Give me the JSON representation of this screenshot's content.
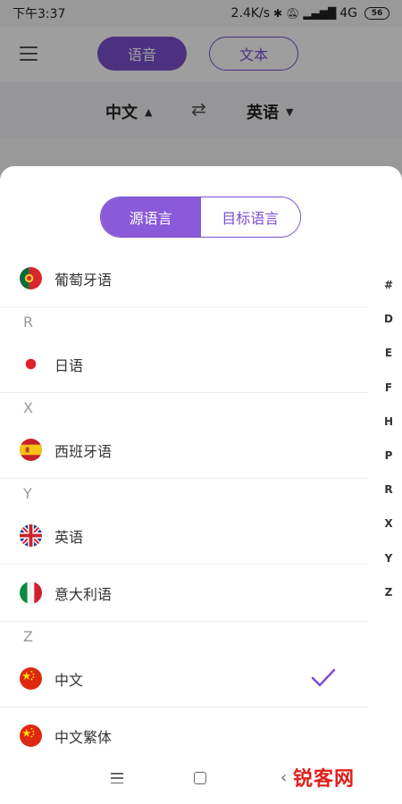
{
  "status_bar": {
    "time": "下午3:37",
    "net_speed": "2.4K/s",
    "network": "4G",
    "battery": "56"
  },
  "top_bar": {
    "voice_tab": "语音",
    "text_tab": "文本"
  },
  "lang_bar": {
    "source": "中文",
    "target": "英语"
  },
  "sheet": {
    "segments": {
      "source": "源语言",
      "target": "目标语言"
    },
    "rows": [
      {
        "kind": "lang",
        "name": "葡萄牙语",
        "flag": "portugal-flag-icon"
      },
      {
        "kind": "section",
        "letter": "R"
      },
      {
        "kind": "lang",
        "name": "日语",
        "flag": "japan-flag-icon"
      },
      {
        "kind": "section",
        "letter": "X"
      },
      {
        "kind": "lang",
        "name": "西班牙语",
        "flag": "spain-flag-icon"
      },
      {
        "kind": "section",
        "letter": "Y"
      },
      {
        "kind": "lang",
        "name": "英语",
        "flag": "uk-flag-icon"
      },
      {
        "kind": "lang",
        "name": "意大利语",
        "flag": "italy-flag-icon"
      },
      {
        "kind": "section",
        "letter": "Z"
      },
      {
        "kind": "lang",
        "name": "中文",
        "flag": "china-flag-icon",
        "selected": true
      },
      {
        "kind": "lang",
        "name": "中文繁体",
        "flag": "china-flag-icon"
      }
    ],
    "alpha_index": [
      "#",
      "D",
      "E",
      "F",
      "H",
      "P",
      "R",
      "X",
      "Y",
      "Z"
    ]
  },
  "watermark": "锐客网",
  "colors": {
    "accent": "#7b4fd1",
    "check": "#7b4fd1"
  }
}
